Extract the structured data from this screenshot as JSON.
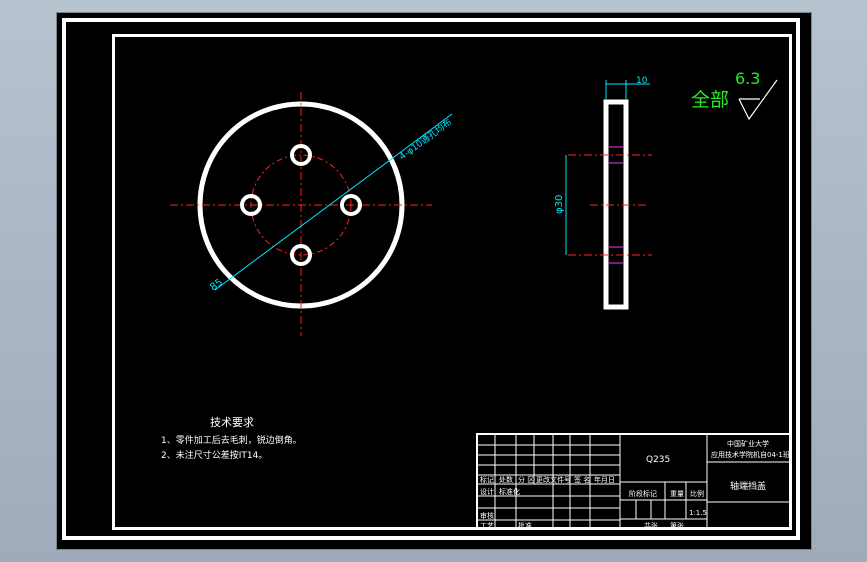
{
  "drawing": {
    "circle_view": {
      "hole_callout": "4-φ10通孔均布",
      "diameter_label": "85"
    },
    "side_view": {
      "thickness_label": "10",
      "diameter_label": "φ30"
    },
    "roughness": {
      "prefix": "全部",
      "value": "6.3"
    }
  },
  "technical_requirements": {
    "title": "技术要求",
    "items": [
      "1、零件加工后去毛刺，锐边倒角。",
      "2、未注尺寸公差按IT14。"
    ]
  },
  "title_block": {
    "material": "Q235",
    "school_line1": "中国矿业大学",
    "school_line2": "应用技术学院机自04-1班",
    "part_name": "轴端挡盖",
    "row_mark": "标记",
    "row_count": "处数",
    "row_zone": "分 区",
    "row_change_doc": "更改文件号",
    "row_sign": "签 名",
    "row_date": "年月日",
    "row_designer": "设计",
    "row_standardize": "标准化",
    "row_review": "审核",
    "row_process": "工艺",
    "row_approve": "批准",
    "stage_mark": "阶段标记",
    "weight": "重量",
    "scale": "比例",
    "scale_value": "1:1.5",
    "sheet_total": "共张",
    "sheet_no": "第张"
  },
  "colors": {
    "line_main": "#ffffff",
    "center_line": "#ff2020",
    "dimension": "#00e5ff",
    "roughness": "#22ee22",
    "hidden": "#ff33ff"
  }
}
